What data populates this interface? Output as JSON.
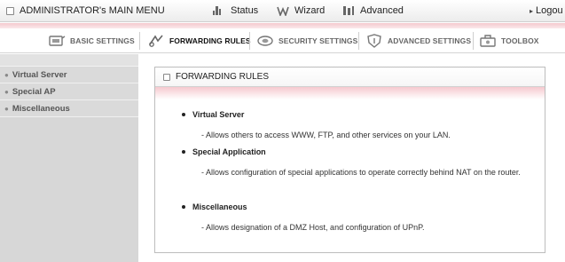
{
  "topbar": {
    "main_menu": "ADMINISTRATOR's MAIN MENU",
    "status": "Status",
    "wizard": "Wizard",
    "advanced": "Advanced",
    "logout": "Logou"
  },
  "tabs": [
    {
      "label": "BASIC SETTINGS",
      "icon": "basic-settings-icon",
      "active": false
    },
    {
      "label": "FORWARDING RULES",
      "icon": "forwarding-rules-icon",
      "active": true
    },
    {
      "label": "SECURITY SETTINGS",
      "icon": "security-settings-icon",
      "active": false
    },
    {
      "label": "ADVANCED SETTINGS",
      "icon": "advanced-settings-icon",
      "active": false
    },
    {
      "label": "TOOLBOX",
      "icon": "toolbox-icon",
      "active": false
    }
  ],
  "sidebar": {
    "items": [
      {
        "label": "Virtual Server"
      },
      {
        "label": "Special AP"
      },
      {
        "label": "Miscellaneous"
      }
    ]
  },
  "panel": {
    "title": "FORWARDING RULES",
    "entries": [
      {
        "title": "Virtual Server",
        "desc": "- Allows others to access WWW, FTP, and other services on your LAN."
      },
      {
        "title": "Special Application",
        "desc": "- Allows configuration of special applications to operate correctly behind NAT on the router."
      },
      {
        "title": "Miscellaneous",
        "desc": "- Allows designation of a DMZ Host, and configuration of UPnP."
      }
    ]
  },
  "colors": {
    "accent_pink": "#f4c9ce",
    "sidebar_bg": "#d7d7d7",
    "border": "#bdbdbd"
  }
}
